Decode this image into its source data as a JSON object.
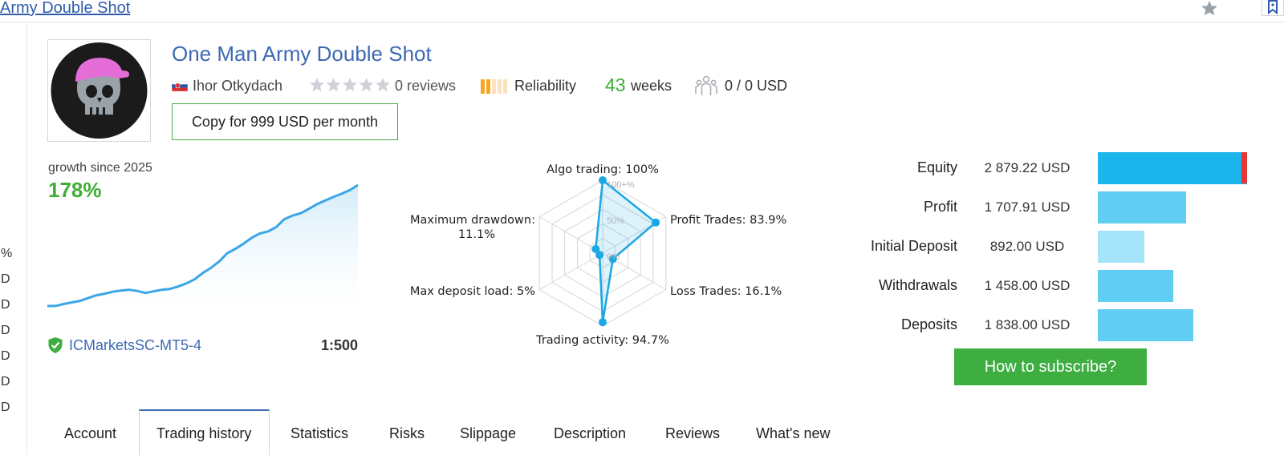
{
  "top_bar": {
    "title": "Army Double Shot"
  },
  "left_stub": [
    "%",
    "D",
    "D",
    "D",
    "D",
    "D",
    "D"
  ],
  "header": {
    "product_title": "One Man Army Double Shot",
    "author": "Ihor Otkydach",
    "rating_stars": 0,
    "reviews": "0 reviews",
    "reliability_label": "Reliability",
    "reliability_level": 0.3,
    "weeks_number": "43",
    "weeks_label": "weeks",
    "subscribers": "0 / 0 USD",
    "copy_button": "Copy for 999 USD per month"
  },
  "growth": {
    "label": "growth since 2025",
    "value": "178%",
    "broker": "ICMarketsSC-MT5-4",
    "leverage": "1:500",
    "curve": [
      0,
      0.1,
      2.5,
      4.5,
      6.5,
      10,
      13.5,
      15.5,
      18,
      19.5,
      20.5,
      19,
      16.5,
      18.5,
      20.5,
      21.5,
      24.5,
      28.5,
      33.5,
      41.5,
      48,
      56,
      66.5,
      72,
      78.5,
      86,
      91.5,
      94,
      99.5,
      109.5,
      114,
      117,
      122.5,
      128.5,
      133,
      137.5,
      141.5,
      146,
      152.5
    ]
  },
  "radar": {
    "labels": {
      "top": "Algo trading: 100%",
      "upper_right": "Profit Trades: 83.9%",
      "lower_right": "Loss Trades: 16.1%",
      "bottom": "Trading activity: 94.7%",
      "lower_left": "Max deposit load: 5%",
      "upper_left_line1": "Maximum drawdown:",
      "upper_left_line2": "11.1%"
    },
    "ring_labels": [
      "100+%",
      "50%",
      "0%"
    ],
    "values": [
      100,
      83.9,
      16.1,
      94.7,
      5,
      11.1
    ]
  },
  "chart_data": {
    "type": "radar",
    "categories": [
      "Algo trading",
      "Profit Trades",
      "Loss Trades",
      "Trading activity",
      "Max deposit load",
      "Maximum drawdown"
    ],
    "values": [
      100,
      83.9,
      16.1,
      94.7,
      5,
      11.1
    ],
    "ring_labels": [
      "100+%",
      "50%",
      "0%"
    ]
  },
  "stats": [
    {
      "label": "Equity",
      "value": "2 879.22 USD",
      "amount": 2879.22,
      "color": "#1cb5ec"
    },
    {
      "label": "Profit",
      "value": "1 707.91 USD",
      "amount": 1707.91,
      "color": "#60cdf3"
    },
    {
      "label": "Initial Deposit",
      "value": "892.00 USD",
      "amount": 892.0,
      "color": "#a6e4f9"
    },
    {
      "label": "Withdrawals",
      "value": "1 458.00 USD",
      "amount": 1458.0,
      "color": "#60cdf3"
    },
    {
      "label": "Deposits",
      "value": "1 838.00 USD",
      "amount": 1838.0,
      "color": "#60cdf3"
    }
  ],
  "subscribe_button": "How to subscribe?",
  "tabs": [
    "Account",
    "Trading history",
    "Statistics",
    "Risks",
    "Slippage",
    "Description",
    "Reviews",
    "What's new"
  ],
  "active_tab": "Trading history",
  "colors": {
    "link_blue": "#3d69b3",
    "green": "#3eae35",
    "radar_blue": "#1aa7e3"
  }
}
